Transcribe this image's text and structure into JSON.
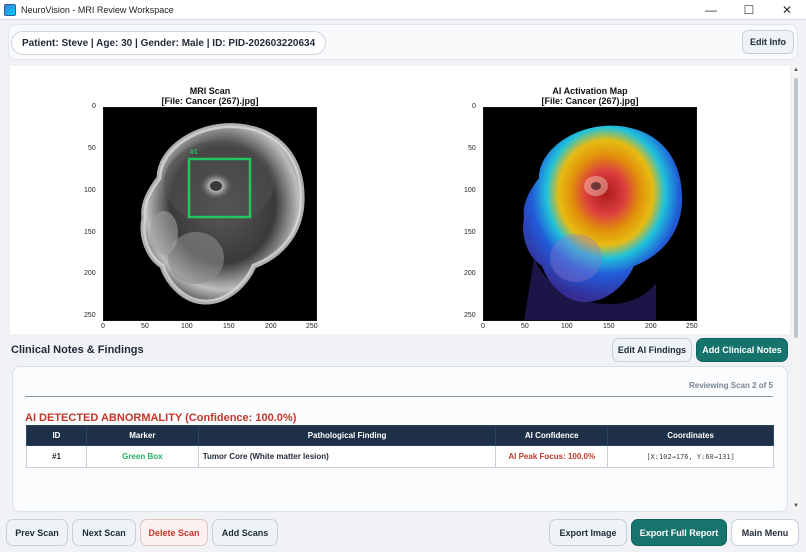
{
  "window": {
    "title": "NeuroVision - MRI Review Workspace",
    "controls": {
      "minimize": "—",
      "maximize": "☐",
      "close": "✕"
    }
  },
  "patient": {
    "summary": "Patient: Steve | Age: 30 | Gender: Male | ID: PID-202603220634",
    "edit_label": "Edit Info"
  },
  "scan_panel": {
    "title": "MRI Scan",
    "subtitle": "[File: Cancer (267).jpg]",
    "box_label": "#1",
    "box_color": "#22c55e"
  },
  "activation_panel": {
    "title": "AI Activation Map",
    "subtitle": "[File: Cancer (267).jpg]"
  },
  "chart_data": [
    {
      "type": "image",
      "title": "MRI Scan\n[File: Cancer (267).jpg]",
      "xticks": [
        0,
        50,
        100,
        150,
        200,
        250
      ],
      "yticks": [
        0,
        50,
        100,
        150,
        200,
        250
      ],
      "xlim": [
        0,
        255
      ],
      "ylim": [
        255,
        0
      ],
      "annotations": [
        {
          "label": "#1",
          "x": [
            102,
            176
          ],
          "y": [
            60,
            131
          ],
          "color": "#22c55e"
        }
      ]
    },
    {
      "type": "heatmap",
      "title": "AI Activation Map\n[File: Cancer (267).jpg]",
      "xticks": [
        0,
        50,
        100,
        150,
        200,
        250
      ],
      "yticks": [
        0,
        50,
        100,
        150,
        200,
        250
      ],
      "xlim": [
        0,
        255
      ],
      "ylim": [
        255,
        0
      ],
      "peak": {
        "x": 140,
        "y": 88
      }
    }
  ],
  "notes": {
    "section_title": "Clinical Notes & Findings",
    "edit_ai_label": "Edit AI Findings",
    "add_notes_label": "Add Clinical Notes",
    "reviewing": "Reviewing Scan 2 of 5",
    "abnormality": "AI DETECTED ABNORMALITY (Confidence: 100.0%)",
    "columns": [
      "ID",
      "Marker",
      "Pathological Finding",
      "AI Confidence",
      "Coordinates"
    ],
    "rows": [
      {
        "id": "#1",
        "marker": "Green Box",
        "finding": "Tumor Core (White matter lesion)",
        "confidence": "AI Peak Focus: 100.0%",
        "coords": "[X:102→176, Y:60→131]"
      }
    ]
  },
  "footer": {
    "prev": "Prev Scan",
    "next": "Next Scan",
    "delete": "Delete Scan",
    "add": "Add Scans",
    "export_image": "Export Image",
    "export_report": "Export Full Report",
    "main_menu": "Main Menu"
  },
  "colors": {
    "teal": "#16746d",
    "header_dark": "#1e3148",
    "danger": "#c0392b",
    "marker_green": "#27ae60"
  }
}
